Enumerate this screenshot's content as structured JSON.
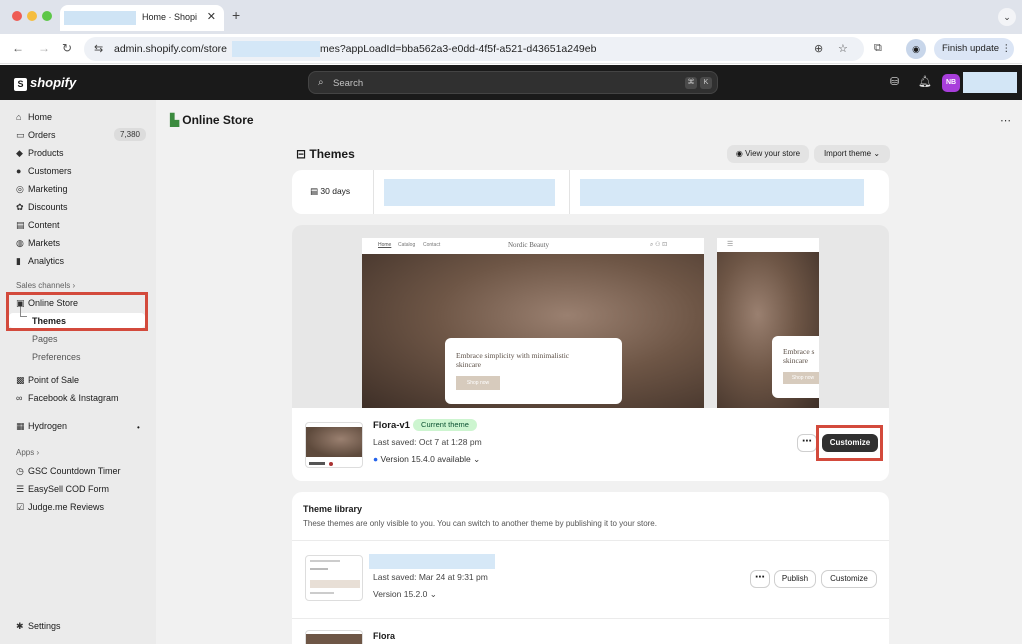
{
  "browser": {
    "tab_title": "Home · Shopi",
    "url_prefix": "admin.shopify.com/store",
    "url_suffix": "mes?appLoadId=bba562a3-e0dd-4f5f-a521-d43651a249eb",
    "finish_update": "Finish update"
  },
  "topbar": {
    "logo_text": "shopify",
    "search_placeholder": "Search",
    "kbd1": "⌘",
    "kbd2": "K",
    "avatar_initials": "NB"
  },
  "sidebar": {
    "home": "Home",
    "orders": "Orders",
    "orders_count": "7,380",
    "products": "Products",
    "customers": "Customers",
    "marketing": "Marketing",
    "discounts": "Discounts",
    "content": "Content",
    "markets": "Markets",
    "analytics": "Analytics",
    "sales_channels": "Sales channels ›",
    "online_store": "Online Store",
    "themes": "Themes",
    "pages": "Pages",
    "preferences": "Preferences",
    "point_of_sale": "Point of Sale",
    "facebook": "Facebook & Instagram",
    "hydrogen": "Hydrogen",
    "apps": "Apps ›",
    "gsc": "GSC Countdown Timer",
    "easysell": "EasySell COD Form",
    "judgeme": "Judge.me Reviews",
    "settings": "Settings"
  },
  "main": {
    "page_title": "Online Store",
    "themes_title": "Themes",
    "view_store": "View your store",
    "import_theme": "Import theme",
    "period": "30 days",
    "preview": {
      "nav_home": "Home",
      "nav_catalog": "Catalog",
      "nav_contact": "Contact",
      "store_name": "Nordic Beauty",
      "hero_line1": "Embrace simplicity with minimalistic",
      "hero_line2": "skincare",
      "mob_line1": "Embrace s",
      "mob_line2": "skincare",
      "shop_now": "Shop now"
    },
    "current": {
      "name": "Flora-v1",
      "badge": "Current theme",
      "last_saved": "Last saved: Oct 7 at 1:28 pm",
      "version": "Version 15.4.0 available",
      "customize": "Customize"
    },
    "library": {
      "title": "Theme library",
      "description": "These themes are only visible to you. You can switch to another theme by publishing it to your store.",
      "item1_saved": "Last saved: Mar 24 at 9:31 pm",
      "item1_version": "Version 15.2.0",
      "publish": "Publish",
      "customize": "Customize",
      "item2_name": "Flora"
    }
  },
  "colors": {
    "highlight": "#d34a3c",
    "current_badge": "#cdf5d0",
    "dark": "#1a1a1a"
  }
}
